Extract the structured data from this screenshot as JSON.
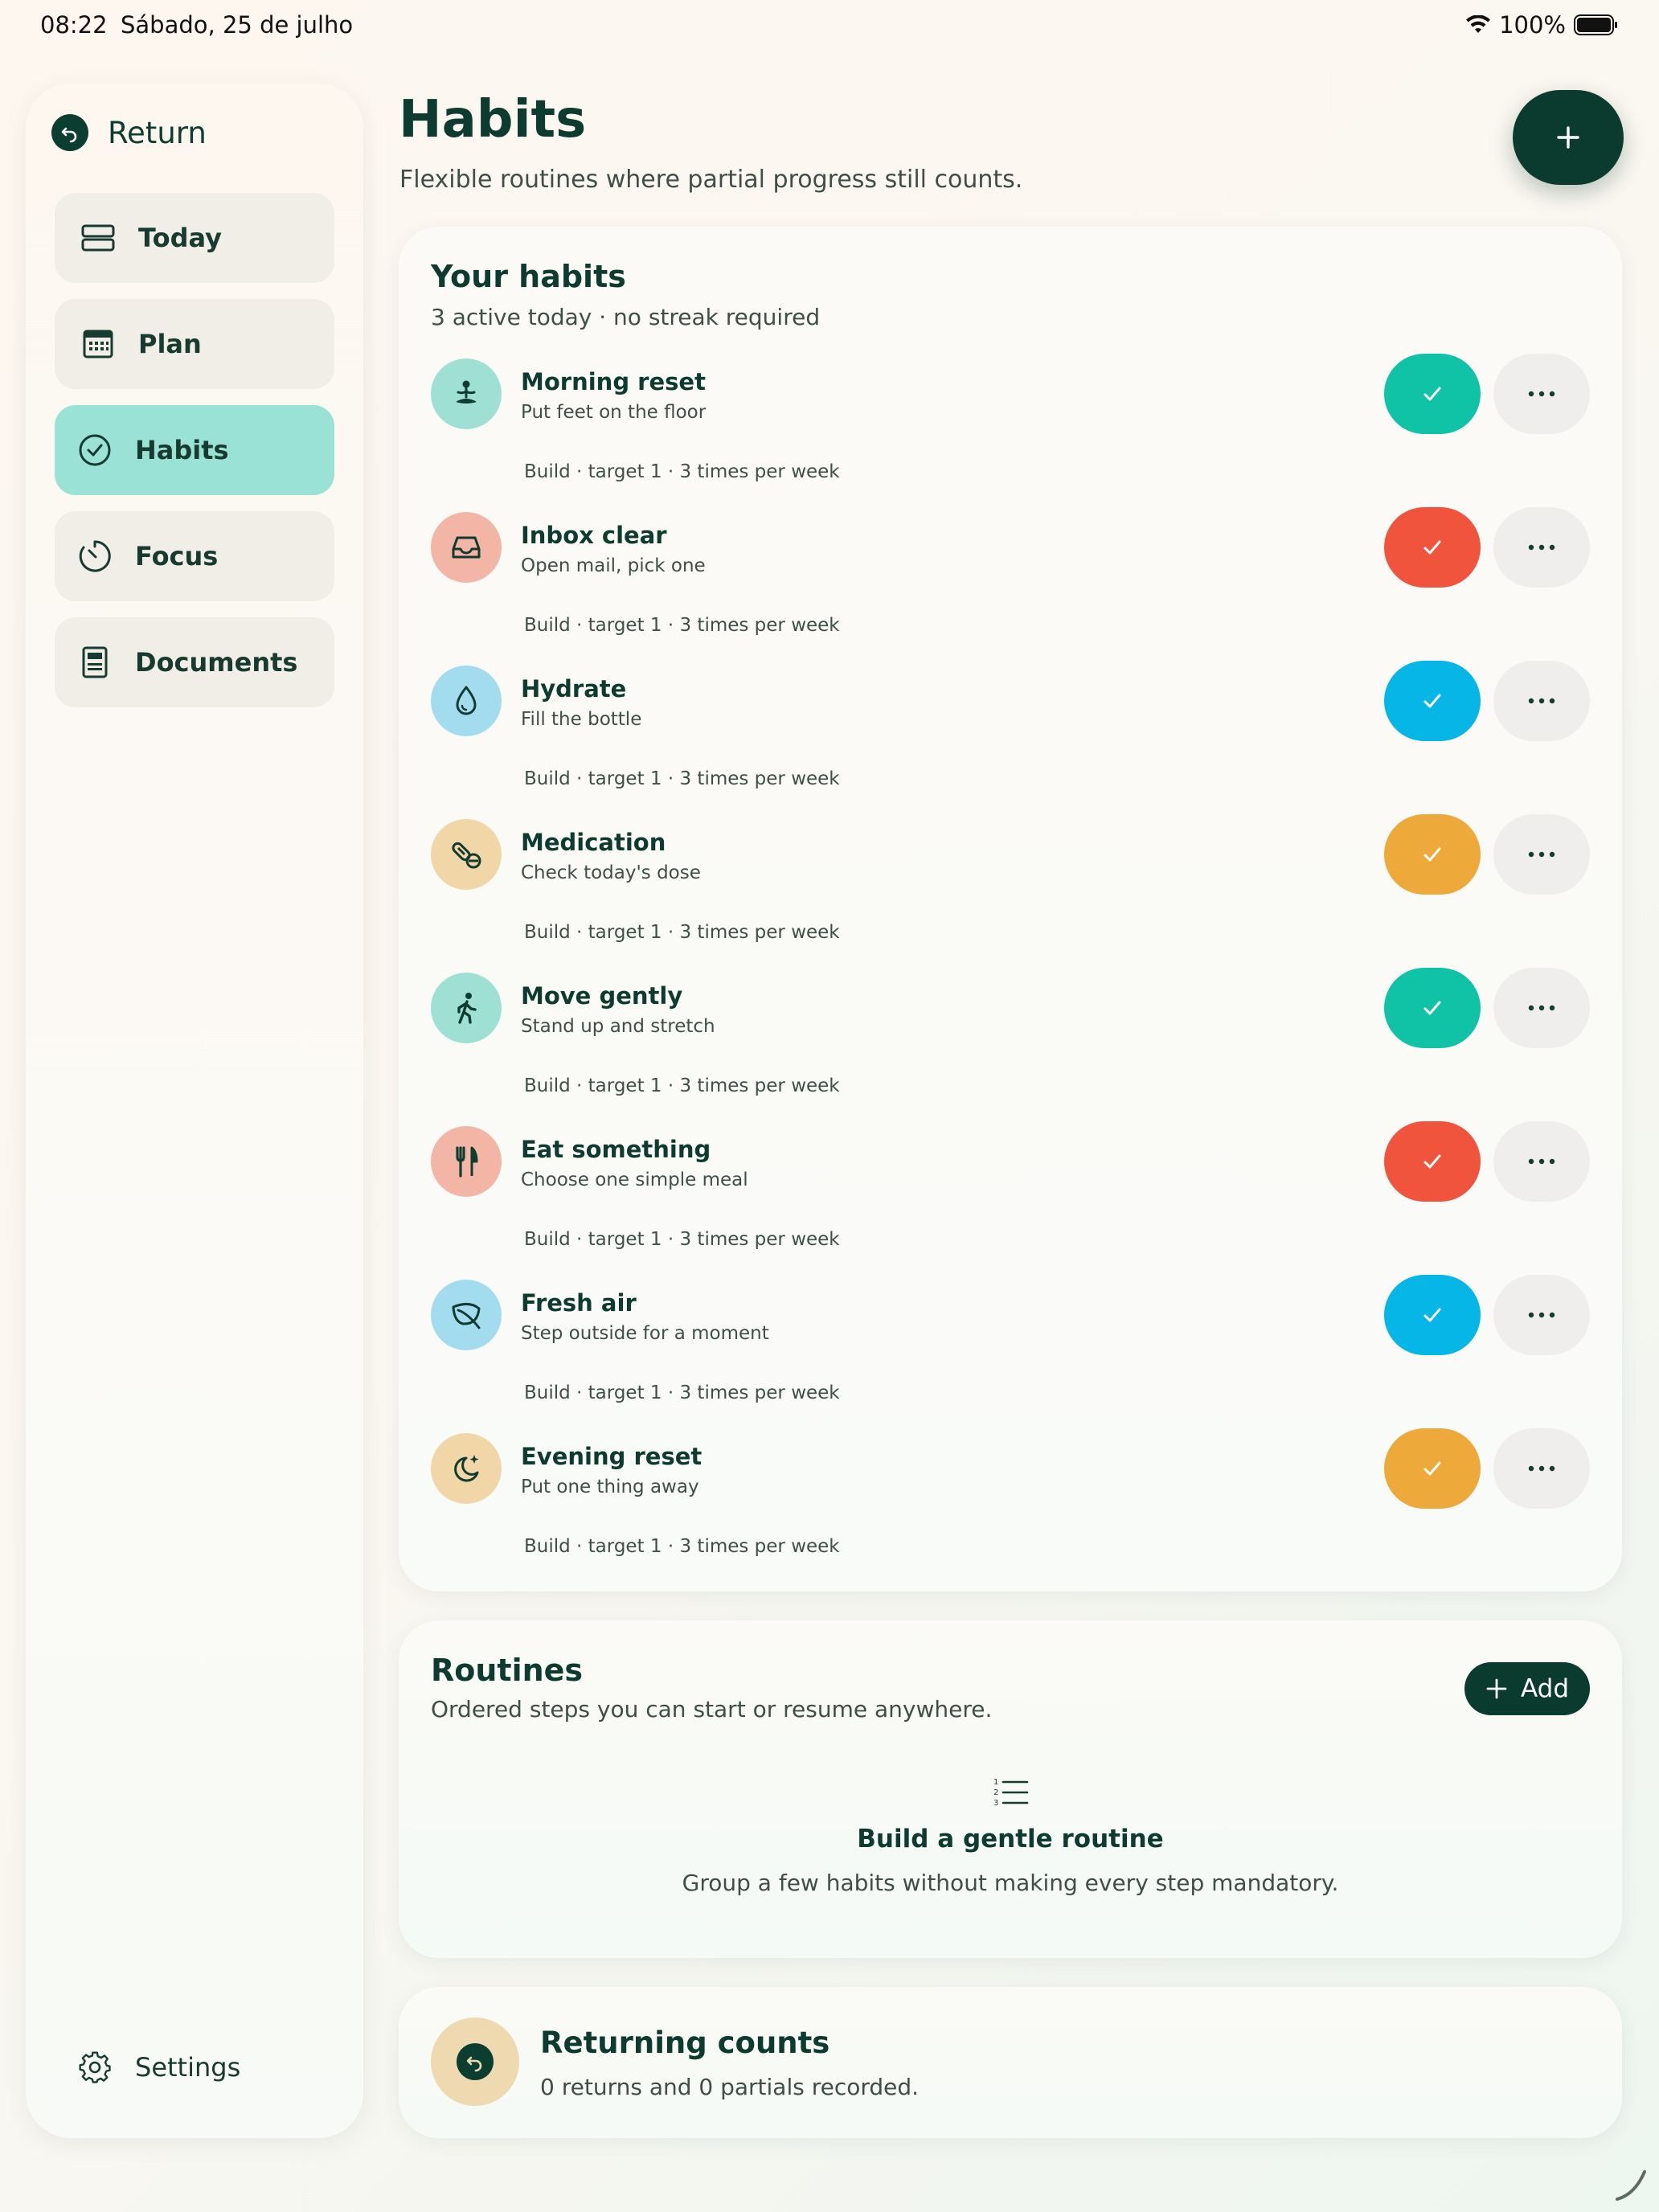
{
  "status_bar": {
    "time": "08:22",
    "date": "Sábado, 25 de julho",
    "battery": "100%",
    "icons": [
      "wifi-icon",
      "battery-icon"
    ]
  },
  "sidebar": {
    "return_label": "Return",
    "items": [
      {
        "label": "Today",
        "icon": "today-icon",
        "active": false
      },
      {
        "label": "Plan",
        "icon": "calendar-icon",
        "active": false
      },
      {
        "label": "Habits",
        "icon": "check-circle-icon",
        "active": true
      },
      {
        "label": "Focus",
        "icon": "timer-icon",
        "active": false
      },
      {
        "label": "Documents",
        "icon": "document-icon",
        "active": false
      }
    ],
    "settings_label": "Settings"
  },
  "header": {
    "title": "Habits",
    "subtitle": "Flexible routines where partial progress still counts."
  },
  "habits_card": {
    "title": "Your habits",
    "subtitle": "3 active today · no streak required",
    "habits": [
      {
        "name": "Morning reset",
        "desc": "Put feet on the floor",
        "meta": "Build · target 1 · 3 times per week",
        "icon": "meditation-icon",
        "icon_bg": "#9fe0d4",
        "accent": "#10c3a6"
      },
      {
        "name": "Inbox clear",
        "desc": "Open mail, pick one",
        "meta": "Build · target 1 · 3 times per week",
        "icon": "inbox-icon",
        "icon_bg": "#f3b6a6",
        "accent": "#f0543c"
      },
      {
        "name": "Hydrate",
        "desc": "Fill the bottle",
        "meta": "Build · target 1 · 3 times per week",
        "icon": "water-drop-icon",
        "icon_bg": "#a4dcef",
        "accent": "#05b6e6"
      },
      {
        "name": "Medication",
        "desc": "Check today's dose",
        "meta": "Build · target 1 · 3 times per week",
        "icon": "pill-icon",
        "icon_bg": "#f1d6a8",
        "accent": "#edaa3a"
      },
      {
        "name": "Move gently",
        "desc": "Stand up and stretch",
        "meta": "Build · target 1 · 3 times per week",
        "icon": "walking-icon",
        "icon_bg": "#9fe0d4",
        "accent": "#10c3a6"
      },
      {
        "name": "Eat something",
        "desc": "Choose one simple meal",
        "meta": "Build · target 1 · 3 times per week",
        "icon": "fork-knife-icon",
        "icon_bg": "#f3b6a6",
        "accent": "#f0543c"
      },
      {
        "name": "Fresh air",
        "desc": "Step outside for a moment",
        "meta": "Build · target 1 · 3 times per week",
        "icon": "leaf-icon",
        "icon_bg": "#a4dcef",
        "accent": "#05b6e6"
      },
      {
        "name": "Evening reset",
        "desc": "Put one thing away",
        "meta": "Build · target 1 · 3 times per week",
        "icon": "moon-icon",
        "icon_bg": "#f1d6a8",
        "accent": "#edaa3a"
      }
    ]
  },
  "routines_card": {
    "title": "Routines",
    "subtitle": "Ordered steps you can start or resume anywhere.",
    "add_label": "Add",
    "empty_title": "Build a gentle routine",
    "empty_desc": "Group a few habits without making every step mandatory."
  },
  "returning_card": {
    "title": "Returning counts",
    "subtitle": "0 returns and 0 partials recorded."
  },
  "colors": {
    "brand_dark": "#0b3a2f",
    "nav_active": "#9ae2d6",
    "nav_inactive": "#f1ede7"
  }
}
